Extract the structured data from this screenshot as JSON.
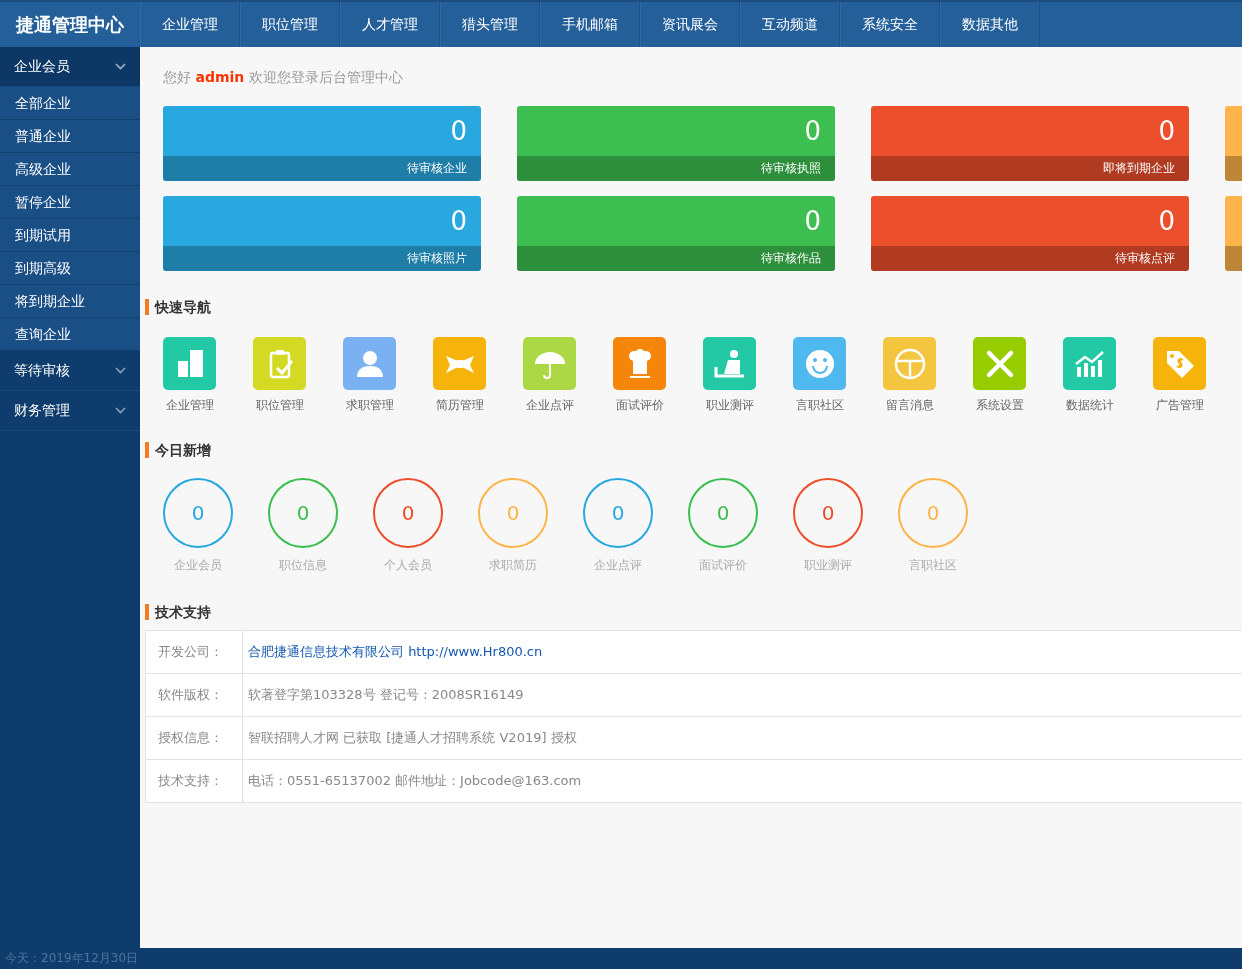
{
  "brand": "捷通管理中心",
  "top_nav": [
    {
      "label": "企业管理"
    },
    {
      "label": "职位管理"
    },
    {
      "label": "人才管理"
    },
    {
      "label": "猎头管理"
    },
    {
      "label": "手机邮箱"
    },
    {
      "label": "资讯展会"
    },
    {
      "label": "互动频道"
    },
    {
      "label": "系统安全"
    },
    {
      "label": "数据其他"
    }
  ],
  "sidebar": {
    "groups": [
      {
        "label": "企业会员",
        "expanded": true,
        "children": [
          {
            "label": "全部企业"
          },
          {
            "label": "普通企业"
          },
          {
            "label": "高级企业"
          },
          {
            "label": "暂停企业"
          },
          {
            "label": "到期试用"
          },
          {
            "label": "到期高级"
          },
          {
            "label": "将到期企业"
          },
          {
            "label": "查询企业"
          }
        ]
      },
      {
        "label": "等待审核",
        "expanded": false
      },
      {
        "label": "财务管理",
        "expanded": false
      }
    ]
  },
  "welcome": {
    "greeting": "您好",
    "user": "admin",
    "message": "欢迎您登录后台管理中心"
  },
  "stat_cards": [
    {
      "count": "0",
      "label": "待审核企业",
      "color": "#29a8e0"
    },
    {
      "count": "0",
      "label": "待审核执照",
      "color": "#3cbf50"
    },
    {
      "count": "0",
      "label": "即将到期企业",
      "color": "#eb4f2c"
    },
    {
      "color": "#fdb44a"
    },
    {
      "count": "0",
      "label": "待审核照片",
      "color": "#29a8e0"
    },
    {
      "count": "0",
      "label": "待审核作品",
      "color": "#3cbf50"
    },
    {
      "count": "0",
      "label": "待审核点评",
      "color": "#eb4f2c"
    },
    {
      "color": "#fdb44a"
    }
  ],
  "quick_nav": {
    "title": "快速导航",
    "items": [
      {
        "label": "企业管理",
        "color": "#22c9a4"
      },
      {
        "label": "职位管理",
        "color": "#d4da24"
      },
      {
        "label": "求职管理",
        "color": "#7ab1f2"
      },
      {
        "label": "简历管理",
        "color": "#f6b40a"
      },
      {
        "label": "企业点评",
        "color": "#acd845"
      },
      {
        "label": "面试评价",
        "color": "#f6860a"
      },
      {
        "label": "职业测评",
        "color": "#22c9a4"
      },
      {
        "label": "言职社区",
        "color": "#4fb8ef"
      },
      {
        "label": "留言消息",
        "color": "#f4c53f"
      },
      {
        "label": "系统设置",
        "color": "#96cc00"
      },
      {
        "label": "数据统计",
        "color": "#22c9a4"
      },
      {
        "label": "广告管理",
        "color": "#f6b40a"
      }
    ]
  },
  "today_new": {
    "title": "今日新增",
    "items": [
      {
        "count": "0",
        "label": "企业会员",
        "color": "#29a8e0"
      },
      {
        "count": "0",
        "label": "职位信息",
        "color": "#3cbf50"
      },
      {
        "count": "0",
        "label": "个人会员",
        "color": "#eb4f2c"
      },
      {
        "count": "0",
        "label": "求职简历",
        "color": "#fdb44a"
      },
      {
        "count": "0",
        "label": "企业点评",
        "color": "#29a8e0"
      },
      {
        "count": "0",
        "label": "面试评价",
        "color": "#3cbf50"
      },
      {
        "count": "0",
        "label": "职业测评",
        "color": "#eb4f2c"
      },
      {
        "count": "0",
        "label": "言职社区",
        "color": "#fdb44a"
      }
    ]
  },
  "support": {
    "title": "技术支持",
    "rows": [
      {
        "label": "开发公司：",
        "kind": "link",
        "value": "合肥捷通信息技术有限公司 http://www.Hr800.cn"
      },
      {
        "label": "软件版权：",
        "kind": "text",
        "value": "软著登字第103328号 登记号：2008SR16149"
      },
      {
        "label": "授权信息：",
        "kind": "text",
        "value": "智联招聘人才网 已获取 [捷通人才招聘系统 V2019] 授权"
      },
      {
        "label": "技术支持：",
        "kind": "text",
        "value": "电话：0551-65137002 邮件地址：Jobcode@163.com"
      }
    ]
  },
  "status_bar": "今天：2019年12月30日"
}
